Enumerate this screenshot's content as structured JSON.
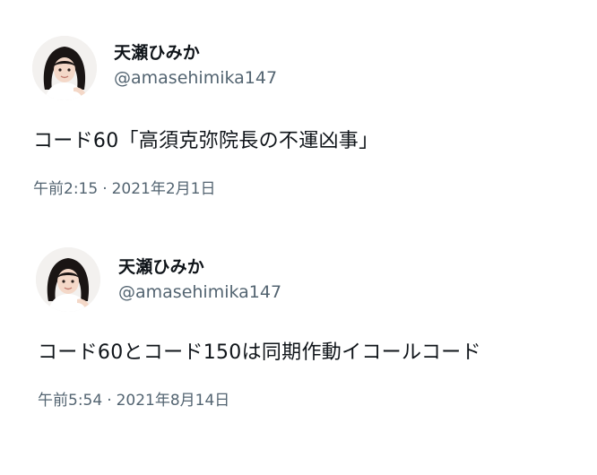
{
  "tweets": [
    {
      "display_name": "天瀬ひみか",
      "handle": "@amasehimika147",
      "text": "コード60「高須克弥院長の不運凶事」",
      "time": "午前2:15",
      "separator": "·",
      "date": "2021年2月1日"
    },
    {
      "display_name": "天瀬ひみか",
      "handle": "@amasehimika147",
      "text": "コード60とコード150は同期作動イコールコード",
      "time": "午前5:54",
      "separator": "·",
      "date": "2021年8月14日"
    }
  ],
  "colors": {
    "text_primary": "#0f1419",
    "text_secondary": "#536471",
    "background": "#ffffff"
  },
  "icons": {
    "avatar": "profile-photo-girl-with-dark-hair"
  }
}
